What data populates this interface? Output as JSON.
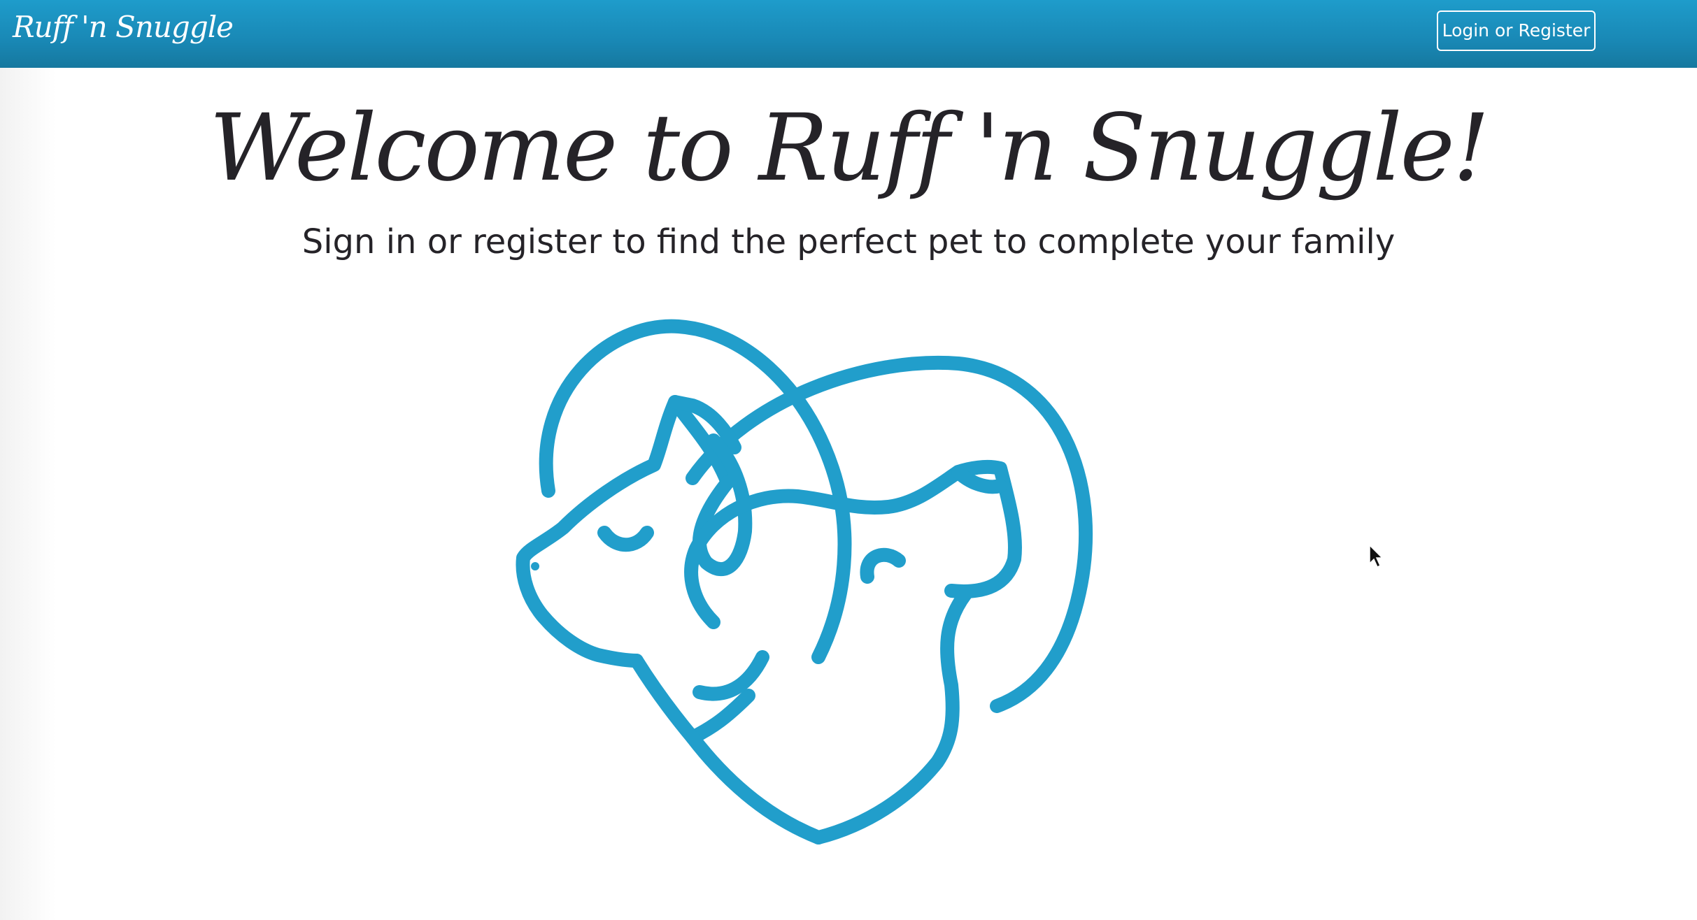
{
  "navbar": {
    "brand": "Ruff 'n Snuggle",
    "login_label": "Login or Register"
  },
  "hero": {
    "title": "Welcome to Ruff 'n Snuggle!",
    "subtitle": "Sign in or register to find the perfect pet to complete your family"
  },
  "logo": {
    "icon": "cat-and-dog-heart-icon",
    "color": "#219ecb"
  },
  "colors": {
    "navbar": "#1a8dba",
    "text": "#252328",
    "accent": "#219ecb"
  }
}
